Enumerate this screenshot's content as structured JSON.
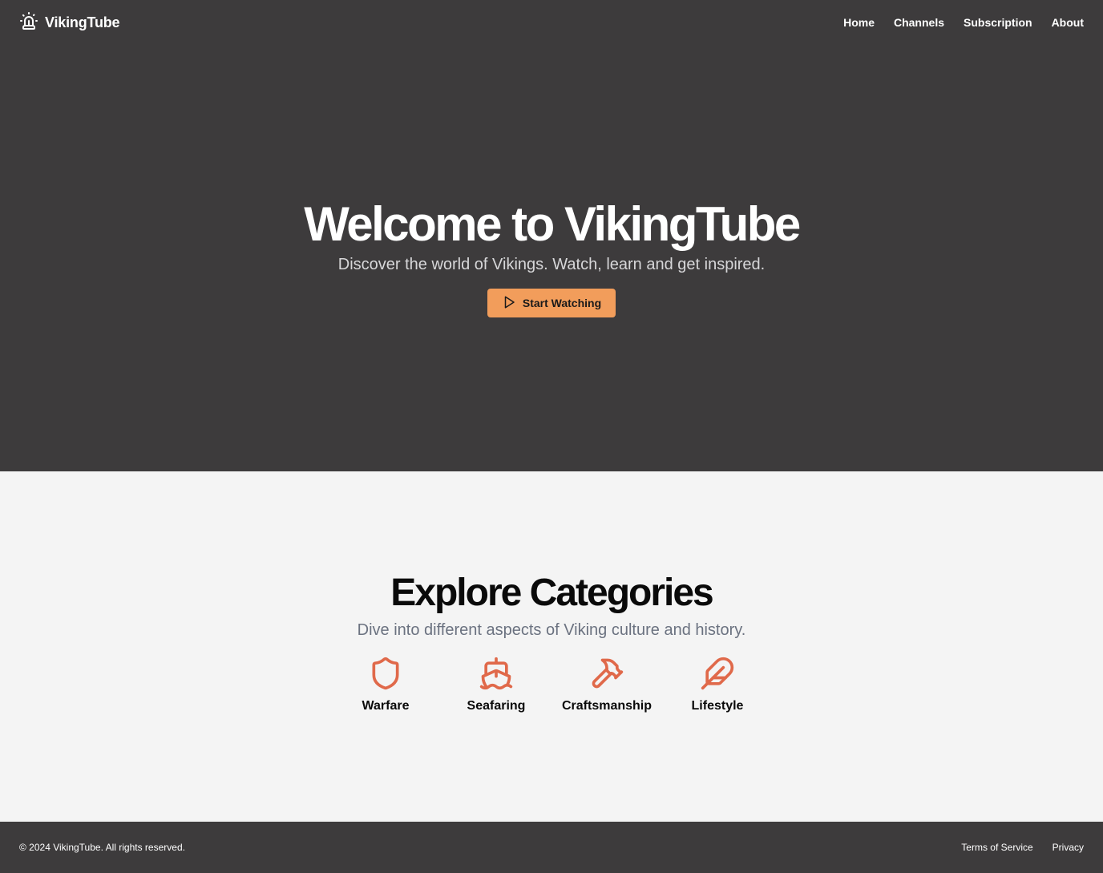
{
  "brand": {
    "name": "VikingTube",
    "icon": "siren-icon"
  },
  "nav": {
    "items": [
      "Home",
      "Channels",
      "Subscription",
      "About"
    ]
  },
  "hero": {
    "title": "Welcome to VikingTube",
    "subtitle": "Discover the world of Vikings. Watch, learn and get inspired.",
    "cta_label": "Start Watching",
    "cta_icon": "play-icon"
  },
  "explore": {
    "title": "Explore Categories",
    "subtitle": "Dive into different aspects of Viking culture and history.",
    "categories": [
      {
        "label": "Warfare",
        "icon": "shield-icon"
      },
      {
        "label": "Seafaring",
        "icon": "ship-icon"
      },
      {
        "label": "Craftsmanship",
        "icon": "hammer-icon"
      },
      {
        "label": "Lifestyle",
        "icon": "feather-icon"
      }
    ]
  },
  "footer": {
    "copyright": "© 2024 VikingTube. All rights reserved.",
    "links": [
      "Terms of Service",
      "Privacy"
    ]
  },
  "colors": {
    "dark_background": "#3d3b3c",
    "light_background": "#f4f4f4",
    "accent": "#f29d5b",
    "icon_accent": "#e0694a"
  }
}
